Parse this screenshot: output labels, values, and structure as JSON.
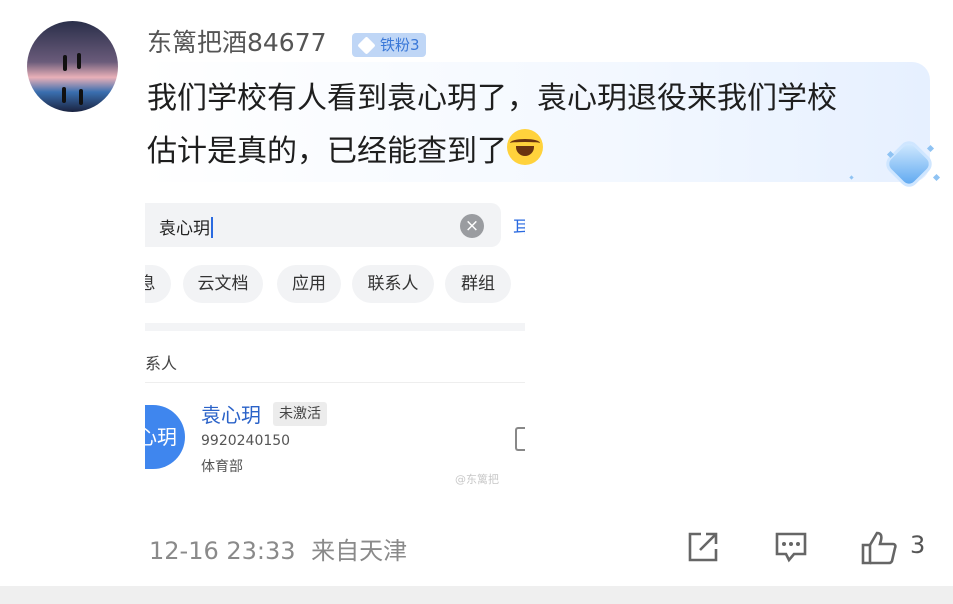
{
  "user": {
    "name": "东篱把酒84677",
    "badge": "铁粉3"
  },
  "comment": {
    "line1": "我们学校有人看到袁心玥了，袁心玥退役来我们学校",
    "line2": "估计是真的，已经能查到了",
    "emoji": "laughing-crying-emoji"
  },
  "screenshot": {
    "search_value": "袁心玥",
    "edge_char": "耳",
    "tabs": [
      "息",
      "云文档",
      "应用",
      "联系人",
      "群组"
    ],
    "section_label": "系人",
    "contact": {
      "name": "袁心玥",
      "avatar_text": "心玥",
      "status": "未激活",
      "id": "9920240150",
      "department": "体育部"
    },
    "watermark": "@东篱把"
  },
  "footer": {
    "timestamp": "12-16 23:33",
    "location": "来自天津",
    "like_count": "3"
  },
  "colors": {
    "badge_bg": "#bfd6f6",
    "link_blue": "#2a62c8",
    "accent": "#3f86ee"
  }
}
